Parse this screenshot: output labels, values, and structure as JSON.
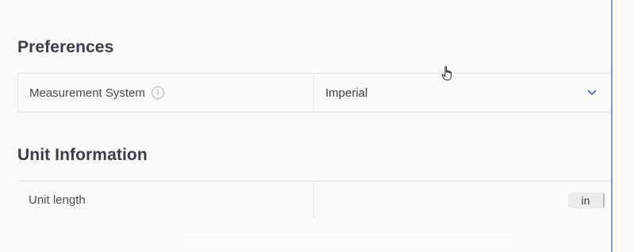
{
  "sections": {
    "preferences": {
      "title": "Preferences",
      "measurement_system": {
        "label": "Measurement System",
        "info_icon": "info-circle-icon",
        "value": "Imperial",
        "dropdown_icon": "chevron-down-icon"
      }
    },
    "unit_information": {
      "title": "Unit Information",
      "unit_length": {
        "label": "Unit length",
        "value": "in"
      }
    }
  },
  "colors": {
    "accent": "#4a67d6",
    "right_border": "#8b93e8",
    "text": "#3a3d4a",
    "border": "#e3e4e8"
  }
}
